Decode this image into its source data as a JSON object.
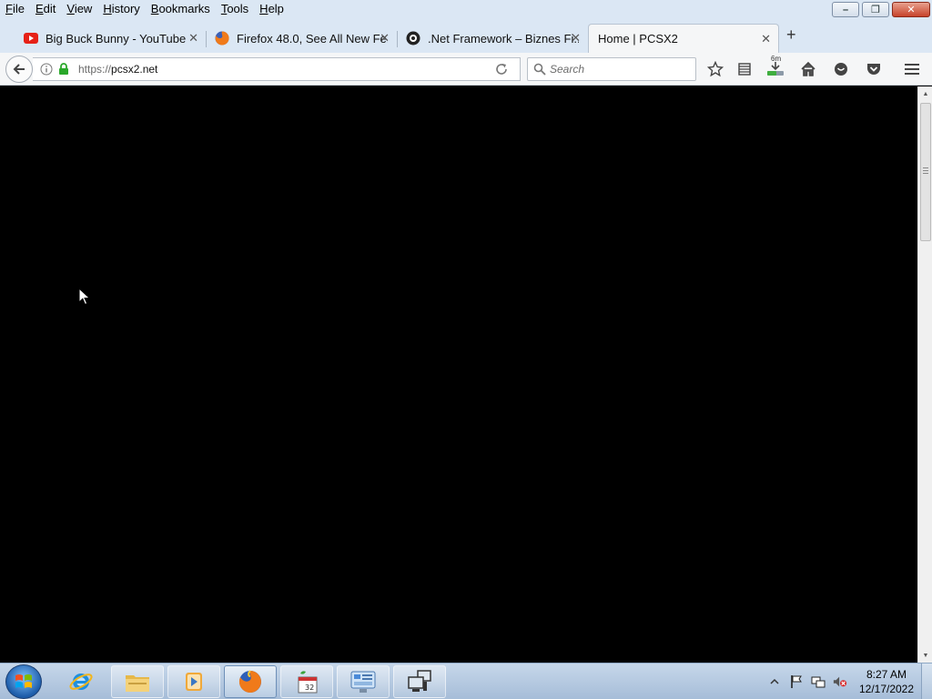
{
  "menu": {
    "items": [
      {
        "label": "File",
        "accel": "F",
        "rest": "ile"
      },
      {
        "label": "Edit",
        "accel": "E",
        "rest": "dit"
      },
      {
        "label": "View",
        "accel": "V",
        "rest": "iew"
      },
      {
        "label": "History",
        "accel": "H",
        "rest": "istory"
      },
      {
        "label": "Bookmarks",
        "accel": "B",
        "rest": "ookmarks"
      },
      {
        "label": "Tools",
        "accel": "T",
        "rest": "ools"
      },
      {
        "label": "Help",
        "accel": "H",
        "rest": "elp"
      }
    ]
  },
  "window_controls": {
    "minimize": "–",
    "restore": "❐",
    "close": "✕"
  },
  "tabs": [
    {
      "title": "Big Buck Bunny - YouTube",
      "icon": "youtube-icon",
      "active": false
    },
    {
      "title": "Firefox 48.0, See All New Fe...",
      "icon": "firefox-icon",
      "active": false
    },
    {
      "title": ".Net Framework – Biznes Fi...",
      "icon": "site-icon",
      "active": false
    },
    {
      "title": "Home | PCSX2",
      "icon": "",
      "active": true
    }
  ],
  "tab_close": "✕",
  "new_tab": "+",
  "navbar": {
    "url_scheme": "https://",
    "url_host": "pcsx2.net",
    "search_placeholder": "Search"
  },
  "toolbar_icons": [
    "bookmark-star-icon",
    "reading-list-icon",
    "download-icon",
    "home-icon",
    "chat-icon",
    "pocket-icon",
    "menu-icon"
  ],
  "download_badge": "6m",
  "taskbar": {
    "apps": [
      "internet-explorer-icon",
      "file-explorer-icon",
      "media-player-icon",
      "firefox-icon",
      "calendar-app-icon",
      "control-panel-icon",
      "network-icon"
    ],
    "calendar_badge": "32",
    "clock_time": "8:27 AM",
    "clock_date": "12/17/2022"
  },
  "colors": {
    "content_bg": "#000000",
    "chrome_bg": "#dbe7f4",
    "taskbar": "#b7cbe1"
  }
}
